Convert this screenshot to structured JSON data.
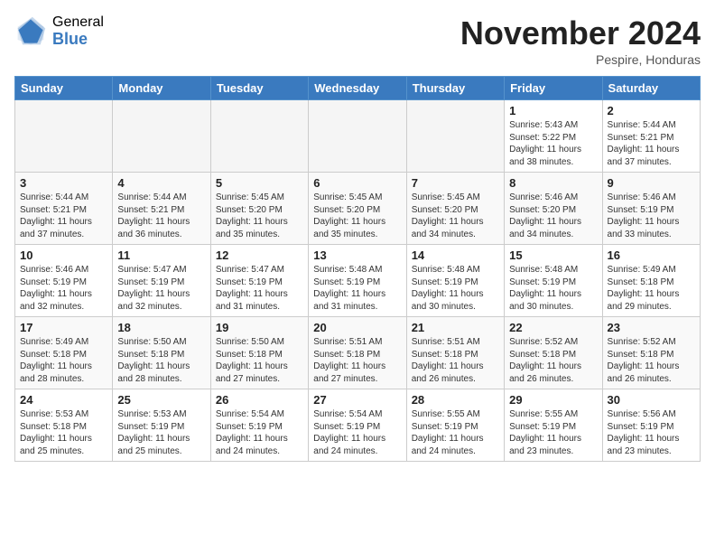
{
  "logo": {
    "general": "General",
    "blue": "Blue"
  },
  "header": {
    "month": "November 2024",
    "location": "Pespire, Honduras"
  },
  "weekdays": [
    "Sunday",
    "Monday",
    "Tuesday",
    "Wednesday",
    "Thursday",
    "Friday",
    "Saturday"
  ],
  "weeks": [
    [
      {
        "day": "",
        "info": ""
      },
      {
        "day": "",
        "info": ""
      },
      {
        "day": "",
        "info": ""
      },
      {
        "day": "",
        "info": ""
      },
      {
        "day": "",
        "info": ""
      },
      {
        "day": "1",
        "info": "Sunrise: 5:43 AM\nSunset: 5:22 PM\nDaylight: 11 hours\nand 38 minutes."
      },
      {
        "day": "2",
        "info": "Sunrise: 5:44 AM\nSunset: 5:21 PM\nDaylight: 11 hours\nand 37 minutes."
      }
    ],
    [
      {
        "day": "3",
        "info": "Sunrise: 5:44 AM\nSunset: 5:21 PM\nDaylight: 11 hours\nand 37 minutes."
      },
      {
        "day": "4",
        "info": "Sunrise: 5:44 AM\nSunset: 5:21 PM\nDaylight: 11 hours\nand 36 minutes."
      },
      {
        "day": "5",
        "info": "Sunrise: 5:45 AM\nSunset: 5:20 PM\nDaylight: 11 hours\nand 35 minutes."
      },
      {
        "day": "6",
        "info": "Sunrise: 5:45 AM\nSunset: 5:20 PM\nDaylight: 11 hours\nand 35 minutes."
      },
      {
        "day": "7",
        "info": "Sunrise: 5:45 AM\nSunset: 5:20 PM\nDaylight: 11 hours\nand 34 minutes."
      },
      {
        "day": "8",
        "info": "Sunrise: 5:46 AM\nSunset: 5:20 PM\nDaylight: 11 hours\nand 34 minutes."
      },
      {
        "day": "9",
        "info": "Sunrise: 5:46 AM\nSunset: 5:19 PM\nDaylight: 11 hours\nand 33 minutes."
      }
    ],
    [
      {
        "day": "10",
        "info": "Sunrise: 5:46 AM\nSunset: 5:19 PM\nDaylight: 11 hours\nand 32 minutes."
      },
      {
        "day": "11",
        "info": "Sunrise: 5:47 AM\nSunset: 5:19 PM\nDaylight: 11 hours\nand 32 minutes."
      },
      {
        "day": "12",
        "info": "Sunrise: 5:47 AM\nSunset: 5:19 PM\nDaylight: 11 hours\nand 31 minutes."
      },
      {
        "day": "13",
        "info": "Sunrise: 5:48 AM\nSunset: 5:19 PM\nDaylight: 11 hours\nand 31 minutes."
      },
      {
        "day": "14",
        "info": "Sunrise: 5:48 AM\nSunset: 5:19 PM\nDaylight: 11 hours\nand 30 minutes."
      },
      {
        "day": "15",
        "info": "Sunrise: 5:48 AM\nSunset: 5:19 PM\nDaylight: 11 hours\nand 30 minutes."
      },
      {
        "day": "16",
        "info": "Sunrise: 5:49 AM\nSunset: 5:18 PM\nDaylight: 11 hours\nand 29 minutes."
      }
    ],
    [
      {
        "day": "17",
        "info": "Sunrise: 5:49 AM\nSunset: 5:18 PM\nDaylight: 11 hours\nand 28 minutes."
      },
      {
        "day": "18",
        "info": "Sunrise: 5:50 AM\nSunset: 5:18 PM\nDaylight: 11 hours\nand 28 minutes."
      },
      {
        "day": "19",
        "info": "Sunrise: 5:50 AM\nSunset: 5:18 PM\nDaylight: 11 hours\nand 27 minutes."
      },
      {
        "day": "20",
        "info": "Sunrise: 5:51 AM\nSunset: 5:18 PM\nDaylight: 11 hours\nand 27 minutes."
      },
      {
        "day": "21",
        "info": "Sunrise: 5:51 AM\nSunset: 5:18 PM\nDaylight: 11 hours\nand 26 minutes."
      },
      {
        "day": "22",
        "info": "Sunrise: 5:52 AM\nSunset: 5:18 PM\nDaylight: 11 hours\nand 26 minutes."
      },
      {
        "day": "23",
        "info": "Sunrise: 5:52 AM\nSunset: 5:18 PM\nDaylight: 11 hours\nand 26 minutes."
      }
    ],
    [
      {
        "day": "24",
        "info": "Sunrise: 5:53 AM\nSunset: 5:18 PM\nDaylight: 11 hours\nand 25 minutes."
      },
      {
        "day": "25",
        "info": "Sunrise: 5:53 AM\nSunset: 5:19 PM\nDaylight: 11 hours\nand 25 minutes."
      },
      {
        "day": "26",
        "info": "Sunrise: 5:54 AM\nSunset: 5:19 PM\nDaylight: 11 hours\nand 24 minutes."
      },
      {
        "day": "27",
        "info": "Sunrise: 5:54 AM\nSunset: 5:19 PM\nDaylight: 11 hours\nand 24 minutes."
      },
      {
        "day": "28",
        "info": "Sunrise: 5:55 AM\nSunset: 5:19 PM\nDaylight: 11 hours\nand 24 minutes."
      },
      {
        "day": "29",
        "info": "Sunrise: 5:55 AM\nSunset: 5:19 PM\nDaylight: 11 hours\nand 23 minutes."
      },
      {
        "day": "30",
        "info": "Sunrise: 5:56 AM\nSunset: 5:19 PM\nDaylight: 11 hours\nand 23 minutes."
      }
    ]
  ]
}
